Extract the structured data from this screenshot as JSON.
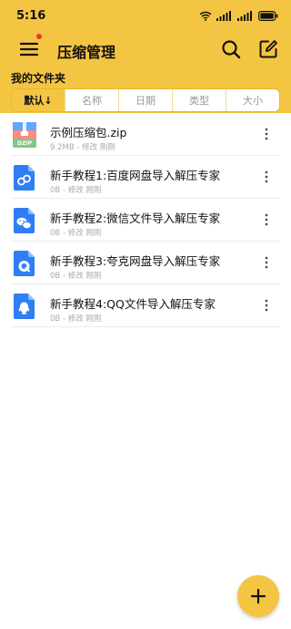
{
  "status_bar": {
    "time": "5:16",
    "icons": [
      "wifi-icon",
      "signal-icon",
      "signal-icon",
      "battery-icon"
    ]
  },
  "app_bar": {
    "title": "压缩管理",
    "menu_icon": "menu-icon",
    "search_icon": "search-icon",
    "edit_icon": "edit-icon",
    "notification_dot_color": "#e53935"
  },
  "folder": {
    "title": "我的文件夹"
  },
  "sort_tabs": [
    {
      "label": "默认↓",
      "active": true
    },
    {
      "label": "名称",
      "active": false
    },
    {
      "label": "日期",
      "active": false
    },
    {
      "label": "类型",
      "active": false
    },
    {
      "label": "大小",
      "active": false
    }
  ],
  "files": [
    {
      "name": "示例压缩包.zip",
      "meta": "9.2MB - 修改 刚刚",
      "icon": "zip-file-icon",
      "icon_badge": "DZIP"
    },
    {
      "name": "新手教程1:百度网盘导入解压专家",
      "meta": "0B - 修改 刚刚",
      "icon": "baidu-netdisk-file-icon"
    },
    {
      "name": "新手教程2:微信文件导入解压专家",
      "meta": "0B - 修改 刚刚",
      "icon": "wechat-file-icon"
    },
    {
      "name": "新手教程3:夸克网盘导入解压专家",
      "meta": "0B - 修改 刚刚",
      "icon": "quark-file-icon"
    },
    {
      "name": "新手教程4:QQ文件导入解压专家",
      "meta": "0B - 修改 刚刚",
      "icon": "qq-file-icon"
    }
  ],
  "fab": {
    "icon": "plus-icon"
  },
  "colors": {
    "accent": "#f4c542",
    "accent_border": "#e6b62e",
    "file_icon_blue": "#2f7ef5"
  }
}
